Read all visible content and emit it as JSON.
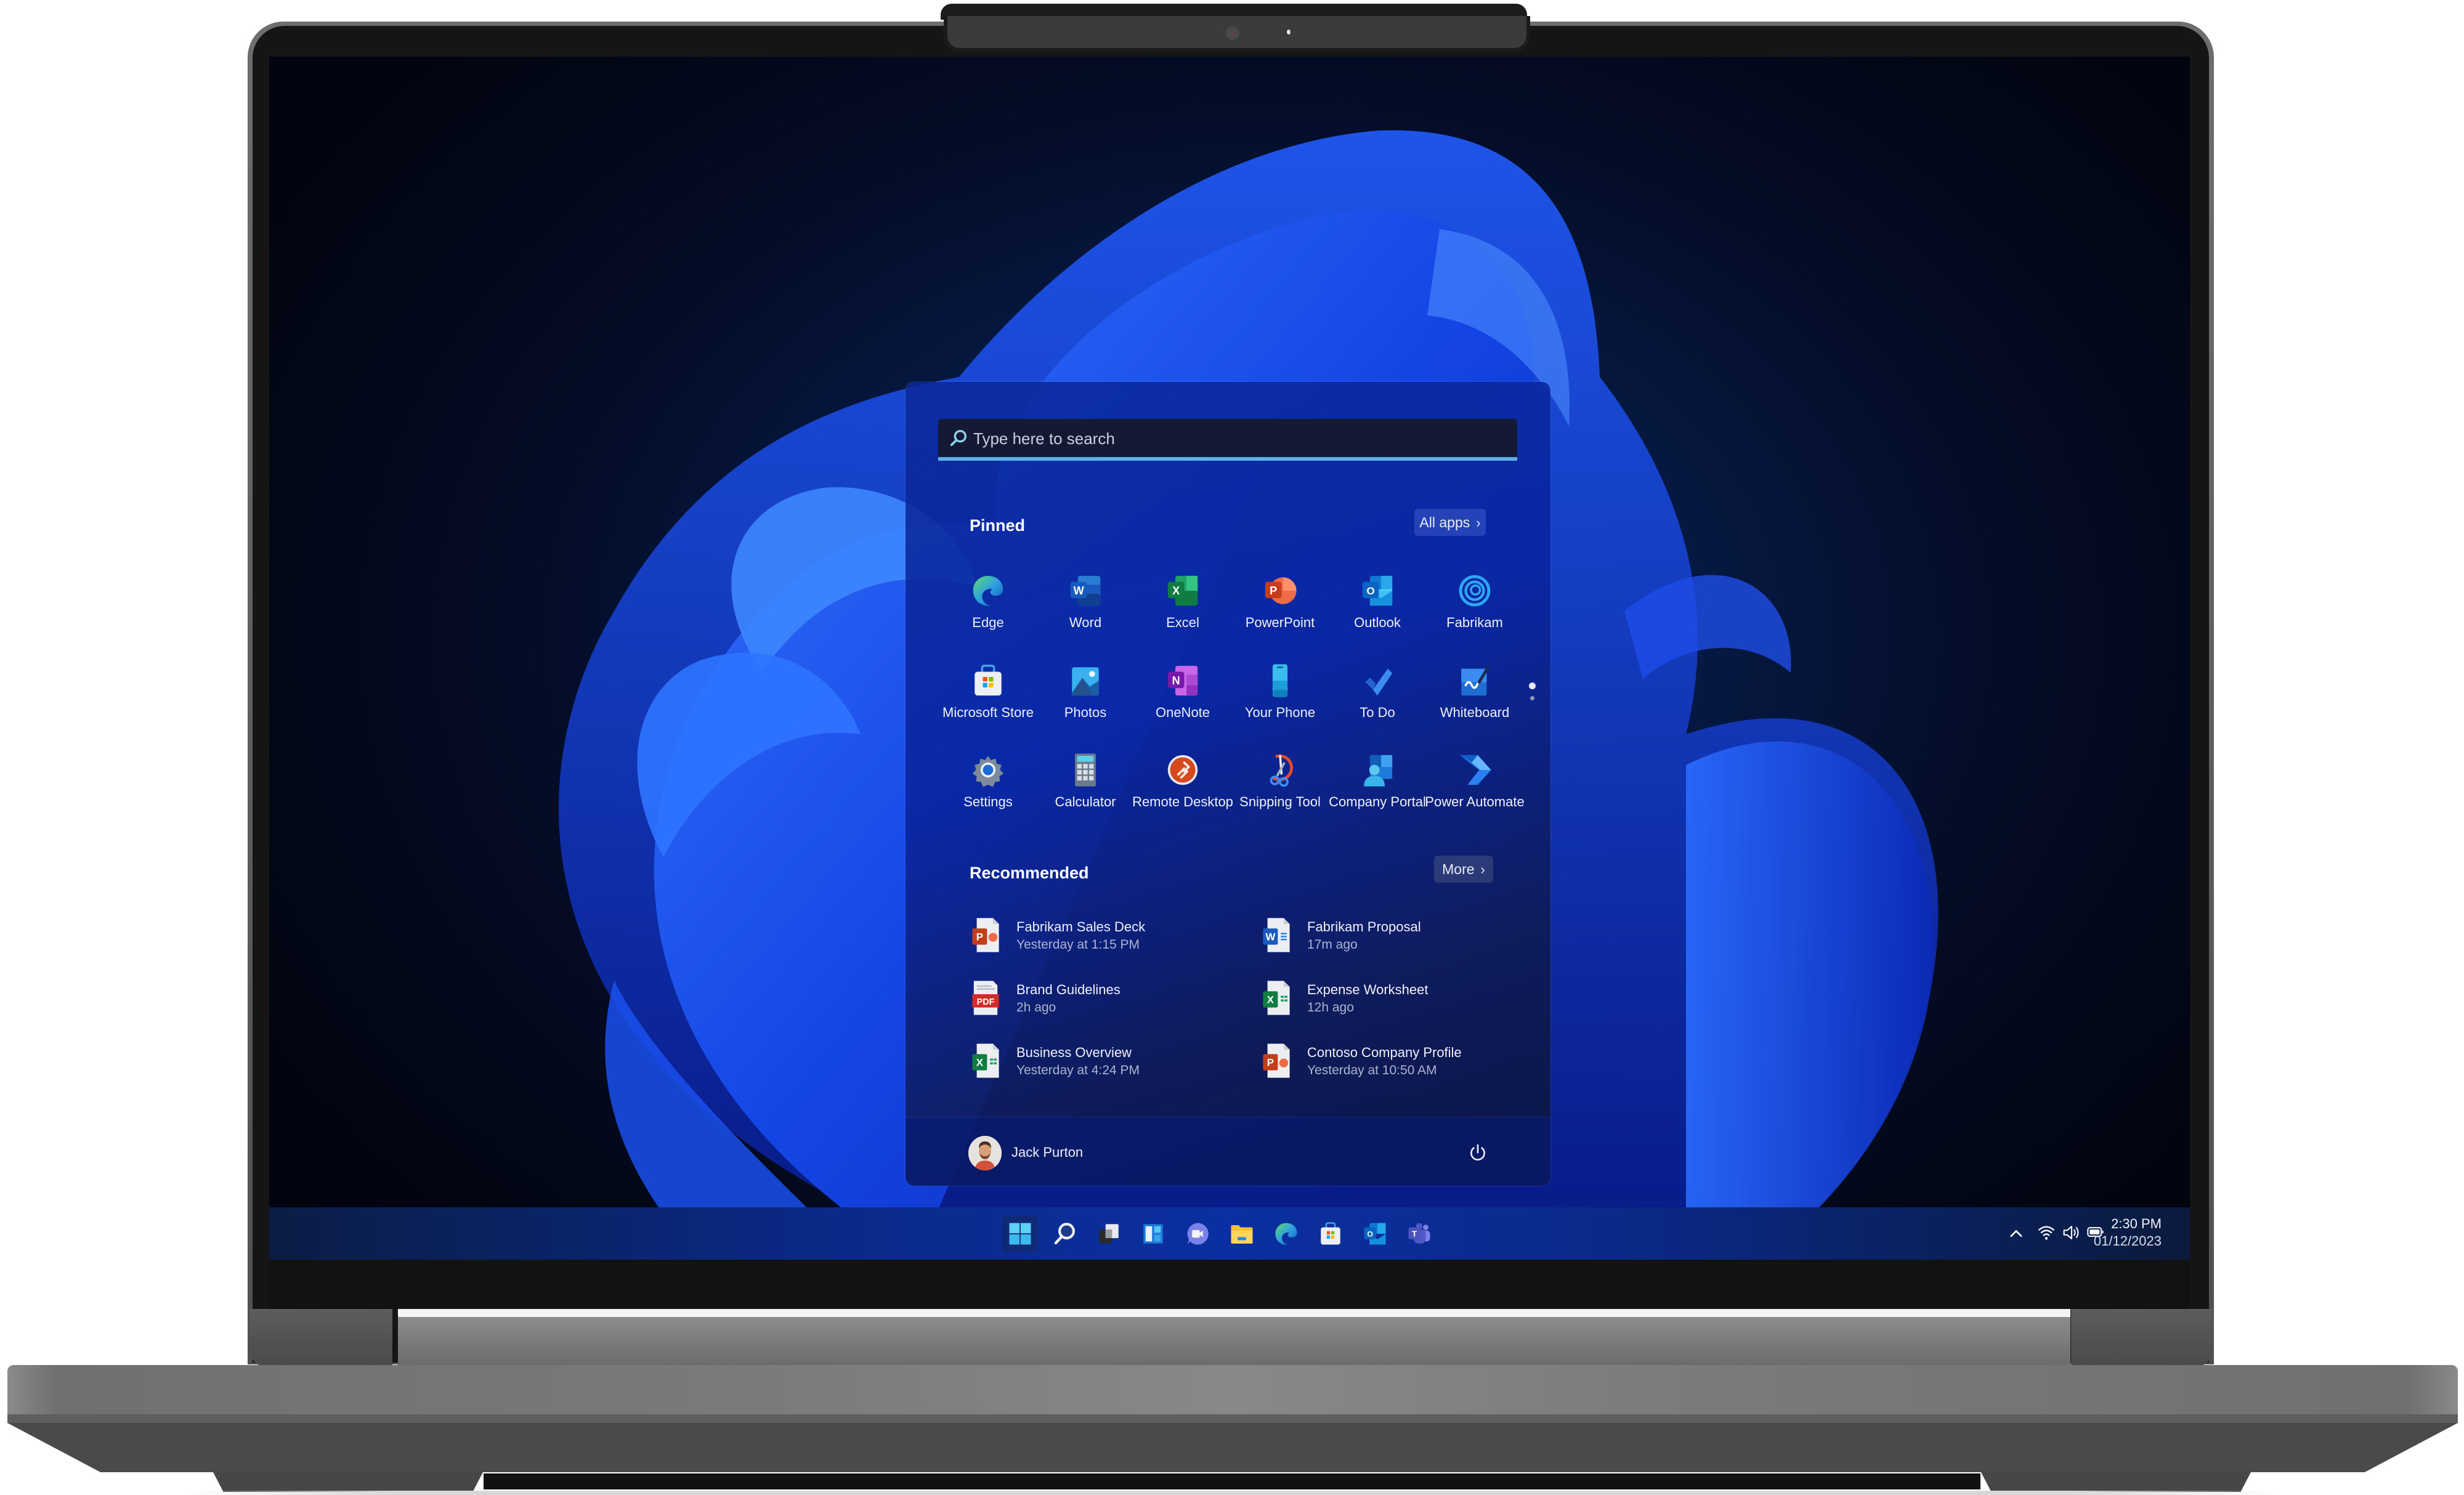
{
  "start_menu": {
    "search": {
      "placeholder": "Type here to search"
    },
    "pinned": {
      "title": "Pinned",
      "all_apps_label": "All apps",
      "apps": [
        {
          "label": "Edge",
          "icon": "edge-icon"
        },
        {
          "label": "Word",
          "icon": "word-icon"
        },
        {
          "label": "Excel",
          "icon": "excel-icon"
        },
        {
          "label": "PowerPoint",
          "icon": "powerpoint-icon"
        },
        {
          "label": "Outlook",
          "icon": "outlook-icon"
        },
        {
          "label": "Fabrikam",
          "icon": "fabrikam-icon"
        },
        {
          "label": "Microsoft Store",
          "icon": "store-icon"
        },
        {
          "label": "Photos",
          "icon": "photos-icon"
        },
        {
          "label": "OneNote",
          "icon": "onenote-icon"
        },
        {
          "label": "Your Phone",
          "icon": "phone-icon"
        },
        {
          "label": "To Do",
          "icon": "todo-icon"
        },
        {
          "label": "Whiteboard",
          "icon": "whiteboard-icon"
        },
        {
          "label": "Settings",
          "icon": "settings-icon"
        },
        {
          "label": "Calculator",
          "icon": "calculator-icon"
        },
        {
          "label": "Remote Desktop",
          "icon": "remote-desktop-icon"
        },
        {
          "label": "Snipping Tool",
          "icon": "snipping-tool-icon"
        },
        {
          "label": "Company Portal",
          "icon": "company-portal-icon"
        },
        {
          "label": "Power Automate",
          "icon": "power-automate-icon"
        }
      ],
      "page_indicator": {
        "current": 1,
        "total": 2
      }
    },
    "recommended": {
      "title": "Recommended",
      "more_label": "More",
      "items": [
        {
          "name": "Fabrikam Sales Deck",
          "time": "Yesterday at 1:15 PM",
          "type": "pptx"
        },
        {
          "name": "Fabrikam Proposal",
          "time": "17m ago",
          "type": "docx"
        },
        {
          "name": "Brand Guidelines",
          "time": "2h ago",
          "type": "pdf"
        },
        {
          "name": "Expense Worksheet",
          "time": "12h ago",
          "type": "xlsx"
        },
        {
          "name": "Business Overview",
          "time": "Yesterday at 4:24 PM",
          "type": "xlsx"
        },
        {
          "name": "Contoso Company Profile",
          "time": "Yesterday at 10:50 AM",
          "type": "pptx"
        }
      ]
    },
    "user": {
      "name": "Jack Purton"
    }
  },
  "taskbar": {
    "apps": [
      "start-icon",
      "search-icon",
      "task-view-icon",
      "widgets-icon",
      "teams-chat-icon",
      "file-explorer-icon",
      "edge-icon",
      "store-icon",
      "outlook-icon",
      "teams-icon"
    ],
    "clock": {
      "time": "2:30 PM",
      "date": "01/12/2023"
    }
  },
  "colors": {
    "accent": "#5ab0e8",
    "search_bg": "#141a34",
    "wallpaper_blue": "#1a4fe0"
  }
}
